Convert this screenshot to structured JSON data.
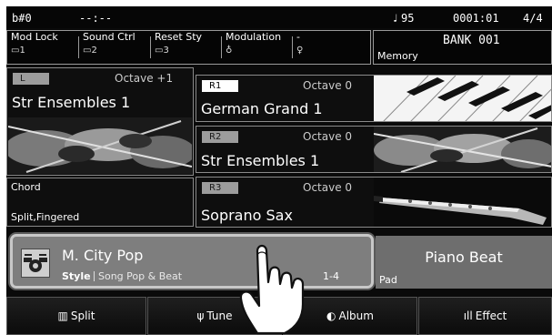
{
  "status_bar": {
    "key": "b#0",
    "chord": "--:--",
    "tempo": "95",
    "measure": "0001:01",
    "time_signature": "4/4"
  },
  "assignable": {
    "items": [
      {
        "label": "Mod Lock",
        "value": "1"
      },
      {
        "label": "Sound Ctrl",
        "value": "2"
      },
      {
        "label": "Reset Sty",
        "value": "3"
      },
      {
        "label": "Modulation",
        "value": ""
      },
      {
        "label": "-",
        "value": ""
      }
    ],
    "memory_bank": "BANK 001",
    "memory_label": "Memory"
  },
  "voices": {
    "left": {
      "tag": "L",
      "octave": "Octave +1",
      "name": "Str Ensembles 1"
    },
    "right1": {
      "tag": "R1",
      "octave": "Octave 0",
      "name": "German Grand 1"
    },
    "right2": {
      "tag": "R2",
      "octave": "Octave 0",
      "name": "Str Ensembles 1"
    },
    "right3": {
      "tag": "R3",
      "octave": "Octave 0",
      "name": "Soprano Sax"
    }
  },
  "chord": {
    "label": "Chord",
    "mode": "Split,Fingered"
  },
  "style": {
    "name": "M. City Pop",
    "category": "Style",
    "subcategory": "Song Pop & Beat",
    "range": "1-4"
  },
  "pad": {
    "name": "Piano Beat",
    "label": "Pad"
  },
  "tabs": [
    {
      "label": "Split",
      "icon": "keyboard-icon"
    },
    {
      "label": "Tune",
      "icon": "tuning-fork-icon"
    },
    {
      "label": "Album",
      "icon": "album-disc-icon"
    },
    {
      "label": "Effect",
      "icon": "equalizer-bars-icon"
    }
  ],
  "colors": {
    "background": "#0a0a0a",
    "style_highlight": "#7e7e7e",
    "pad": "#6e6e6e",
    "tag_gray": "#9c9c9c"
  }
}
